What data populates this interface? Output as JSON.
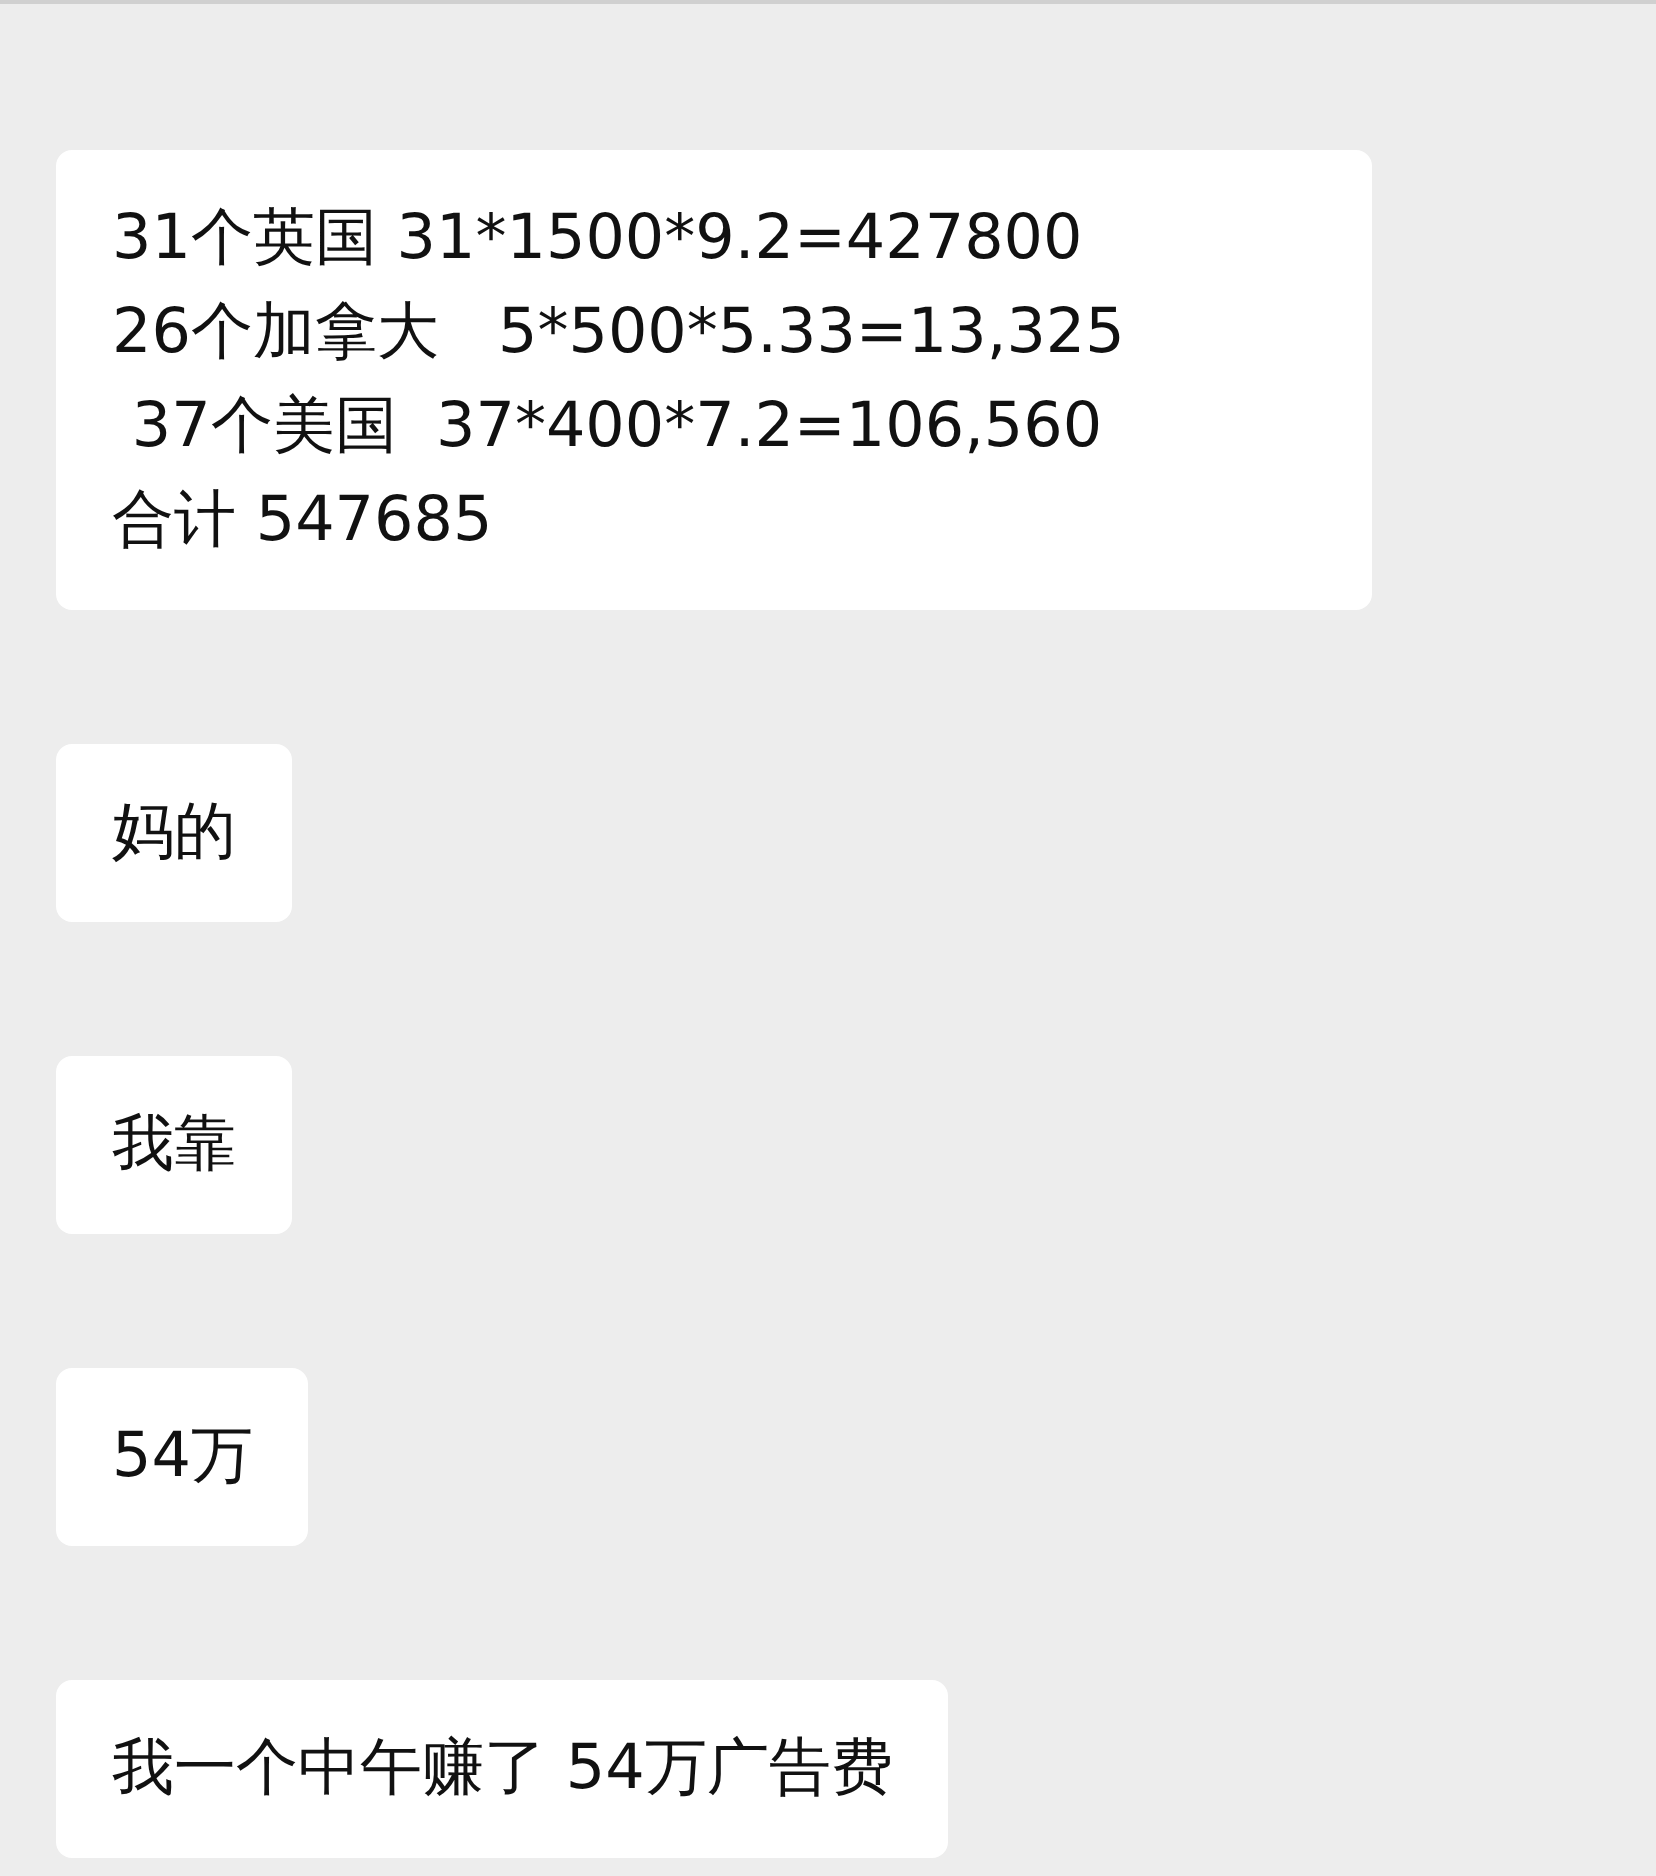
{
  "messages": [
    {
      "lines": [
        "31个英国 31*1500*9.2=427800",
        "26个加拿大   5*500*5.33=13,325",
        " 37个美国  37*400*7.2=106,560",
        "合计 547685"
      ]
    },
    {
      "lines": [
        "妈的"
      ]
    },
    {
      "lines": [
        "我靠"
      ]
    },
    {
      "lines": [
        "54万"
      ]
    },
    {
      "lines": [
        "我一个中午赚了 54万广告费"
      ]
    }
  ]
}
